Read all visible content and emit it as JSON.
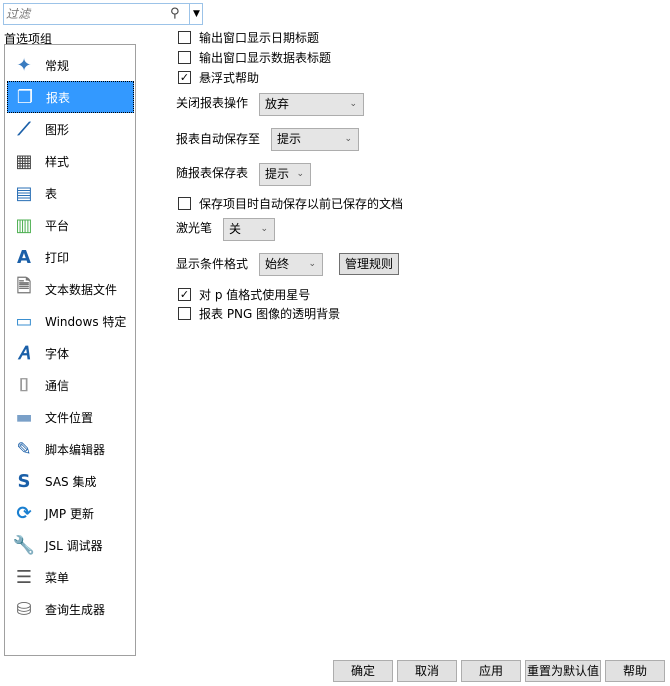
{
  "filter": {
    "placeholder": "过滤"
  },
  "group_label": "首选项组",
  "sidebar": {
    "items": [
      {
        "label": "常规",
        "icon": "jmp-person-icon"
      },
      {
        "label": "报表",
        "icon": "report-pages-icon",
        "selected": true
      },
      {
        "label": "图形",
        "icon": "graph-icon"
      },
      {
        "label": "样式",
        "icon": "styles-icon"
      },
      {
        "label": "表",
        "icon": "table-icon"
      },
      {
        "label": "平台",
        "icon": "platform-icon"
      },
      {
        "label": "打印",
        "icon": "print-icon"
      },
      {
        "label": "文本数据文件",
        "icon": "txt-file-icon"
      },
      {
        "label": "Windows 特定",
        "icon": "monitor-icon"
      },
      {
        "label": "字体",
        "icon": "font-icon"
      },
      {
        "label": "通信",
        "icon": "usb-icon"
      },
      {
        "label": "文件位置",
        "icon": "folder-icon"
      },
      {
        "label": "脚本编辑器",
        "icon": "script-editor-icon"
      },
      {
        "label": "SAS 集成",
        "icon": "sas-icon"
      },
      {
        "label": "JMP 更新",
        "icon": "update-icon"
      },
      {
        "label": "JSL 调试器",
        "icon": "wrench-icon"
      },
      {
        "label": "菜单",
        "icon": "menu-icon"
      },
      {
        "label": "查询生成器",
        "icon": "database-icon"
      }
    ]
  },
  "options": {
    "show_date_title": {
      "label": "输出窗口显示日期标题",
      "checked": false
    },
    "show_table_title": {
      "label": "输出窗口显示数据表标题",
      "checked": false
    },
    "hover_help": {
      "label": "悬浮式帮助",
      "checked": true
    },
    "close_report_action": {
      "label": "关闭报表操作",
      "value": "放弃"
    },
    "autosave_to": {
      "label": "报表自动保存至",
      "value": "提示"
    },
    "save_table_with_report": {
      "label": "随报表保存表",
      "value": "提示"
    },
    "autosave_project": {
      "label": "保存项目时自动保存以前已保存的文档",
      "checked": false
    },
    "laser_pointer": {
      "label": "激光笔",
      "value": "关"
    },
    "conditional_format": {
      "label": "显示条件格式",
      "value": "始终",
      "manage_button": "管理规则"
    },
    "p_value_stars": {
      "label": "对 p 值格式使用星号",
      "checked": true
    },
    "png_transparent": {
      "label": "报表 PNG 图像的透明背景",
      "checked": false
    }
  },
  "footer": {
    "ok": "确定",
    "cancel": "取消",
    "apply": "应用",
    "reset": "重置为默认值",
    "help": "帮助"
  }
}
